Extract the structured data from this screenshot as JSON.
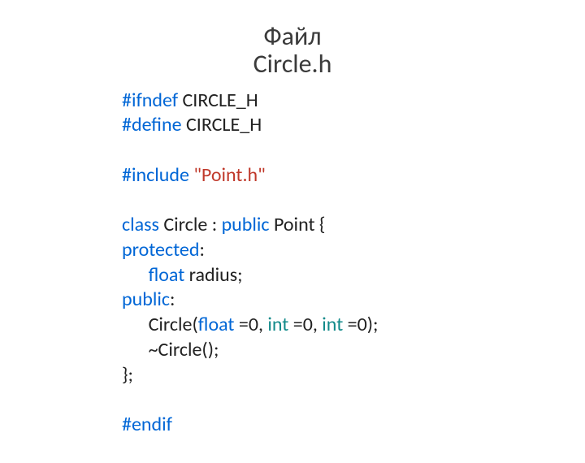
{
  "title": {
    "line1": "Файл",
    "line2": "Circle.h"
  },
  "code": {
    "l1": {
      "kw": "#ifndef",
      "rest": " CIRCLE_H"
    },
    "l2": {
      "kw": "#define",
      "rest": " CIRCLE_H"
    },
    "l3": {
      "kw": "#include ",
      "str": "\"Point.h\""
    },
    "l4": {
      "a": "class ",
      "b": "Circle : ",
      "c": "public ",
      "d": "Point {"
    },
    "l5": {
      "a": "protected",
      "b": ":"
    },
    "l6": {
      "indent": "      ",
      "a": "float ",
      "b": "radius;"
    },
    "l7": {
      "a": "public",
      "b": ":"
    },
    "l8": {
      "indent": "      ",
      "a": "Circle(",
      "b": "float ",
      "c": "=0, ",
      "d": "int ",
      "e": "=0, ",
      "f": "int ",
      "g": "=0);"
    },
    "l9": {
      "indent": "      ",
      "a": "~Circle();"
    },
    "l10": {
      "a": "};"
    },
    "l11": {
      "kw": "#endif"
    }
  }
}
